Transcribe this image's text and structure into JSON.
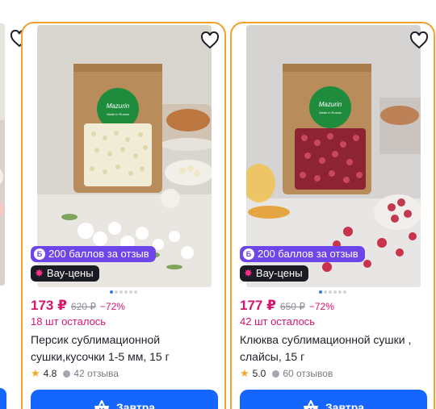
{
  "products": [
    {
      "name": "Персик сублимационной сушки,кусочки 1-5 мм, 15 г",
      "price": "173 ₽",
      "old_price": "620 ₽",
      "discount": "−72%",
      "stock": "18 шт осталось",
      "points_badge": "200 баллов за отзыв",
      "wow_badge": "Вау-цены",
      "rating": "4.8",
      "reviews": "42 отзыва",
      "delivery_button": "Завтра",
      "brand": "Mazurin",
      "brand_tagline": "Made in Russia",
      "fruit_color": "#e9e2c6"
    },
    {
      "name": "Клюква сублимационной сушки , слайсы, 15 г",
      "price": "177 ₽",
      "old_price": "650 ₽",
      "discount": "−72%",
      "stock": "42 шт осталось",
      "points_badge": "200 баллов за отзыв",
      "wow_badge": "Вау-цены",
      "rating": "5.0",
      "reviews": "60 отзывов",
      "delivery_button": "Завтра",
      "brand": "Mazurin",
      "brand_tagline": "Made in Russia",
      "fruit_color": "#b73a4c"
    }
  ],
  "colors": {
    "accent_border": "#f2a02c",
    "price": "#d8156e",
    "points_badge_bg": "#6e45e8",
    "button_bg": "#1466ff",
    "star": "#f5a623"
  },
  "icons": {
    "favorite": "heart-outline-icon",
    "points": "coin-b-icon",
    "wow": "burst-icon",
    "rating": "star-icon",
    "reviews": "speech-bubble-icon",
    "delivery": "basket-icon"
  }
}
